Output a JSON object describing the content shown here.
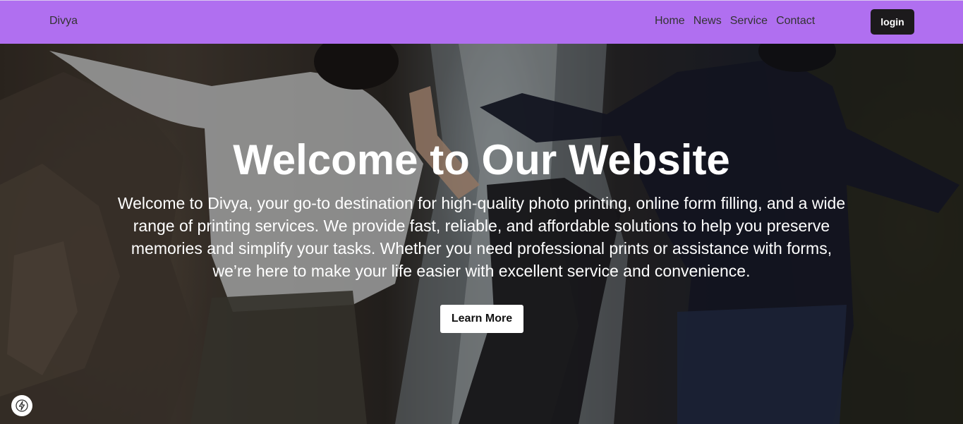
{
  "navbar": {
    "brand": "Divya",
    "links": [
      {
        "label": "Home"
      },
      {
        "label": "News"
      },
      {
        "label": "Service"
      },
      {
        "label": "Contact"
      }
    ],
    "login_label": "login",
    "background_color": "#b06ff0"
  },
  "hero": {
    "title": "Welcome to Our Website",
    "description": "Welcome to Divya, your go-to destination for high-quality photo printing, online form filling, and a wide range of printing services. We provide fast, reliable, and affordable solutions to help you preserve memories and simplify your tasks. Whether you need professional prints or assistance with forms, we’re here to make your life easier with excellent service and convenience.",
    "cta_label": "Learn More",
    "background_image": "people-at-waterfall-photo"
  },
  "corner_badge": {
    "icon": "lightning-bolt-icon"
  }
}
